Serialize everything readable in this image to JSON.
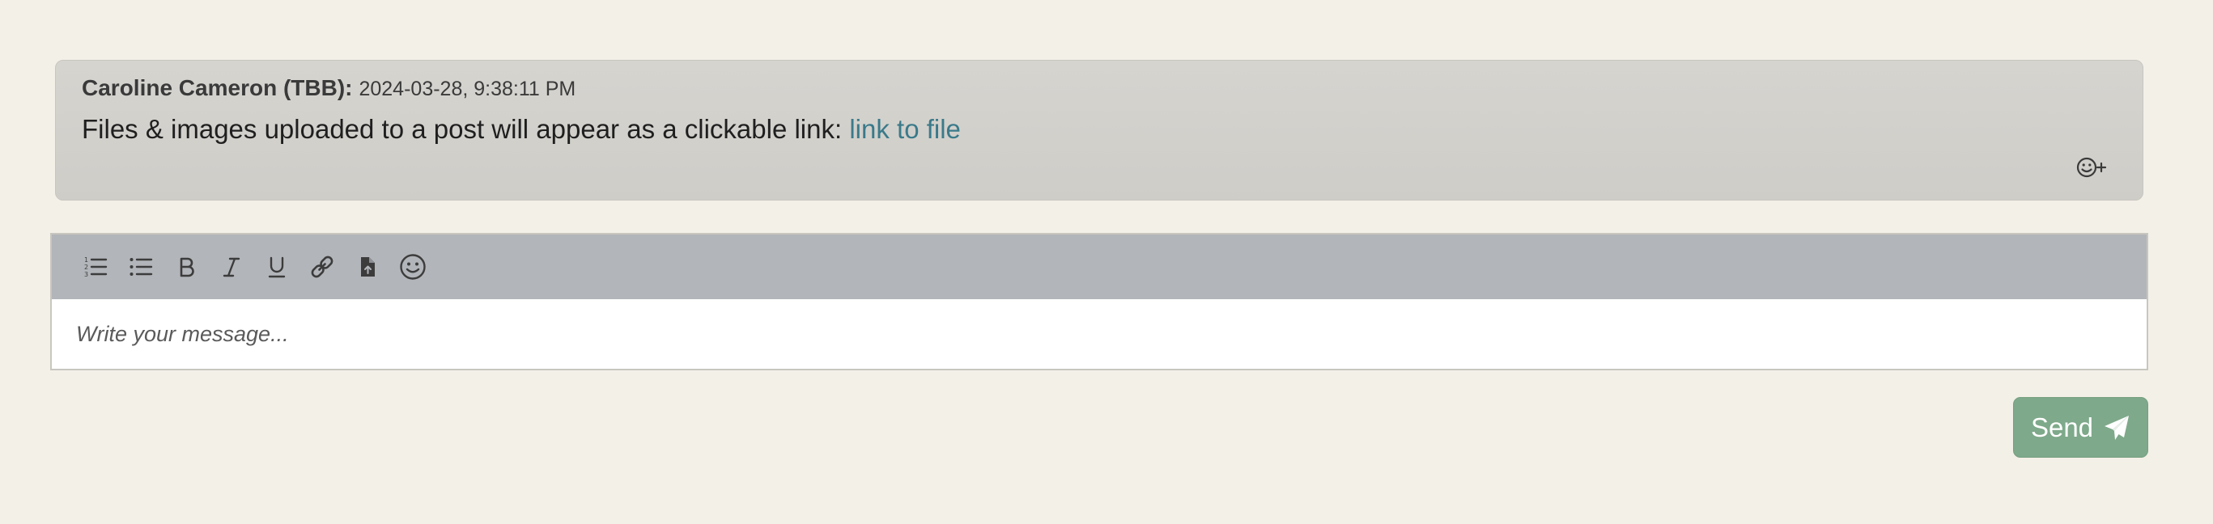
{
  "message": {
    "author": "Caroline Cameron (TBB):",
    "timestamp": "2024-03-28, 9:38:11 PM",
    "body_text": "Files & images uploaded to a post will appear as a clickable link: ",
    "link_text": "link to file"
  },
  "toolbar": {
    "buttons": [
      {
        "name": "ordered-list",
        "icon": "ordered-list-icon"
      },
      {
        "name": "bullet-list",
        "icon": "bullet-list-icon"
      },
      {
        "name": "bold",
        "icon": "bold-icon"
      },
      {
        "name": "italic",
        "icon": "italic-icon"
      },
      {
        "name": "underline",
        "icon": "underline-icon"
      },
      {
        "name": "link",
        "icon": "link-icon"
      },
      {
        "name": "file-upload",
        "icon": "file-upload-icon"
      },
      {
        "name": "emoji",
        "icon": "emoji-icon"
      }
    ]
  },
  "editor": {
    "placeholder": "Write your message..."
  },
  "send": {
    "label": "Send",
    "icon": "paper-plane-icon"
  },
  "colors": {
    "background": "#f3f0e8",
    "message_card": "#d3d1cc",
    "toolbar": "#b2b5b9",
    "link": "#3a7a8a",
    "send_button": "#7ea98a"
  }
}
